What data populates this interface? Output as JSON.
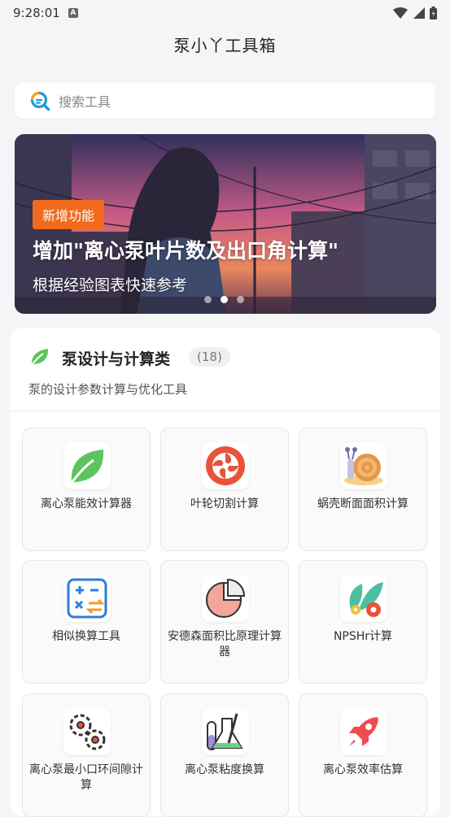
{
  "status_bar": {
    "time": "9:28:01",
    "notification_badge": "A"
  },
  "app": {
    "title": "泵小丫工具箱"
  },
  "search": {
    "placeholder": "搜索工具"
  },
  "banner": {
    "tag": "新增功能",
    "headline": "增加\"离心泵叶片数及出口角计算\"",
    "subtitle": "根据经验图表快速参考",
    "active_dot": 2,
    "dot_count": 3
  },
  "section": {
    "title": "泵设计与计算类",
    "count": "(18)",
    "description": "泵的设计参数计算与优化工具",
    "tools": [
      {
        "label": "离心泵能效计算器",
        "icon": "leaf-icon"
      },
      {
        "label": "叶轮切割计算",
        "icon": "impeller-icon"
      },
      {
        "label": "蜗壳断面面积计算",
        "icon": "snail-icon"
      },
      {
        "label": "相似换算工具",
        "icon": "calculator-icon"
      },
      {
        "label": "安德森面积比原理计算器",
        "icon": "pie-chart-icon"
      },
      {
        "label": "NPSHr计算",
        "icon": "plant-gear-icon"
      },
      {
        "label": "离心泵最小口环间隙计算",
        "icon": "gears-icon"
      },
      {
        "label": "离心泵粘度换算",
        "icon": "lab-tubes-icon"
      },
      {
        "label": "离心泵效率估算",
        "icon": "rocket-icon"
      }
    ]
  },
  "colors": {
    "accent": "#f26a1b",
    "leaf_green": "#5cc45c",
    "background": "#f5f5f7"
  }
}
